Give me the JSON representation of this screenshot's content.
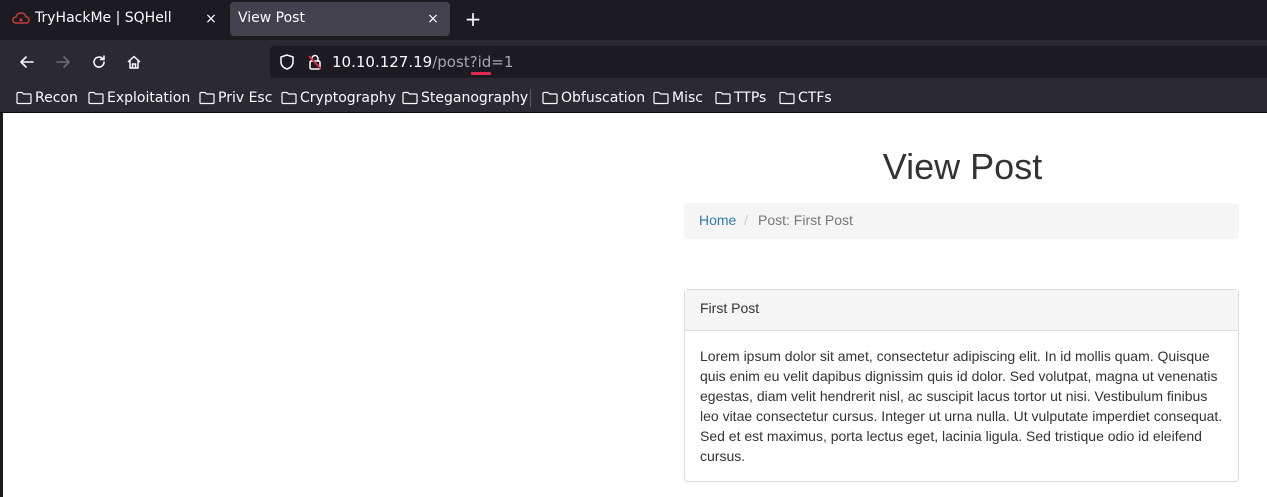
{
  "browser": {
    "tabs": [
      {
        "title": "TryHackMe | SQHell",
        "favicon": "tryhackme-cloud-icon",
        "active": false
      },
      {
        "title": "View Post",
        "active": true
      }
    ],
    "close_glyph": "×",
    "new_tab_glyph": "+",
    "url": {
      "host": "10.10.127.19",
      "path": "/post?id=1",
      "highlight_color": "#e22850"
    },
    "bookmarks": [
      "Recon",
      "Exploitation",
      "Priv Esc",
      "Cryptography",
      "Steganography",
      "Obfuscation",
      "Misc",
      "TTPs",
      "CTFs"
    ]
  },
  "page": {
    "title": "View Post",
    "breadcrumb": {
      "home": "Home",
      "separator": "/",
      "current": "Post: First Post"
    },
    "post": {
      "heading": "First Post",
      "body": "Lorem ipsum dolor sit amet, consectetur adipiscing elit. In id mollis quam. Quisque quis enim eu velit dapibus dignissim quis id dolor. Sed volutpat, magna ut venenatis egestas, diam velit hendrerit nisl, ac suscipit lacus tortor ut nisi. Vestibulum finibus leo vitae consectetur cursus. Integer ut urna nulla. Ut vulputate imperdiet consequat. Sed et est maximus, porta lectus eget, lacinia ligula. Sed tristique odio id eleifend cursus."
    }
  },
  "colors": {
    "link": "#337ab7",
    "browser_dark": "#1c1b22",
    "toolbar": "#2b2a33"
  }
}
